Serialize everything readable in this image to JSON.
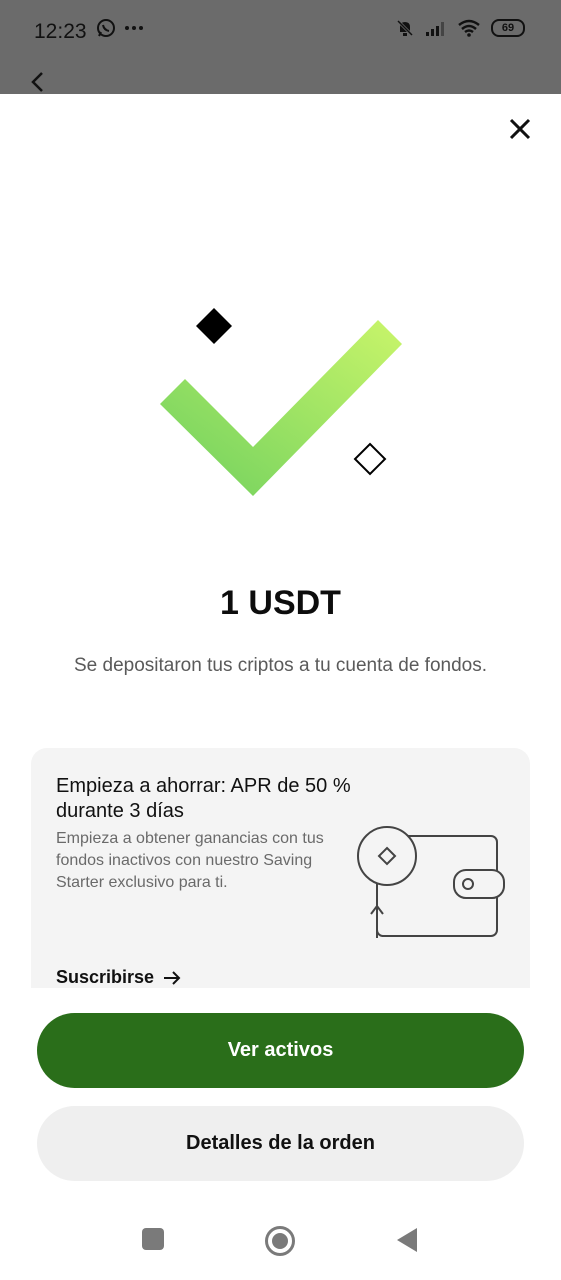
{
  "status_bar": {
    "time": "12:23",
    "icons_left": [
      "whatsapp-icon",
      "more-dots-icon"
    ],
    "icons_right": [
      "mute-bell-icon",
      "signal-icon",
      "wifi-icon"
    ],
    "battery": "69"
  },
  "header": {
    "back": "back-arrow-icon",
    "close": "close-icon"
  },
  "result": {
    "amount": "1 USDT",
    "message": "Se depositaron tus criptos a tu cuenta de fondos."
  },
  "promo": {
    "title": "Empieza a ahorrar: APR de 50 % durante 3 días",
    "description": "Empieza a obtener ganancias con tus fondos inactivos con nuestro Saving Starter exclusivo para ti.",
    "link_label": "Suscribirse",
    "link_icon": "arrow-right-icon"
  },
  "actions": {
    "primary": "Ver activos",
    "secondary": "Detalles de la orden"
  },
  "colors": {
    "primary": "#2a6e1a",
    "check_start": "#c9f56a",
    "check_end": "#6fd05e"
  },
  "nav": [
    "recents-square-icon",
    "home-circle-icon",
    "back-triangle-icon"
  ]
}
